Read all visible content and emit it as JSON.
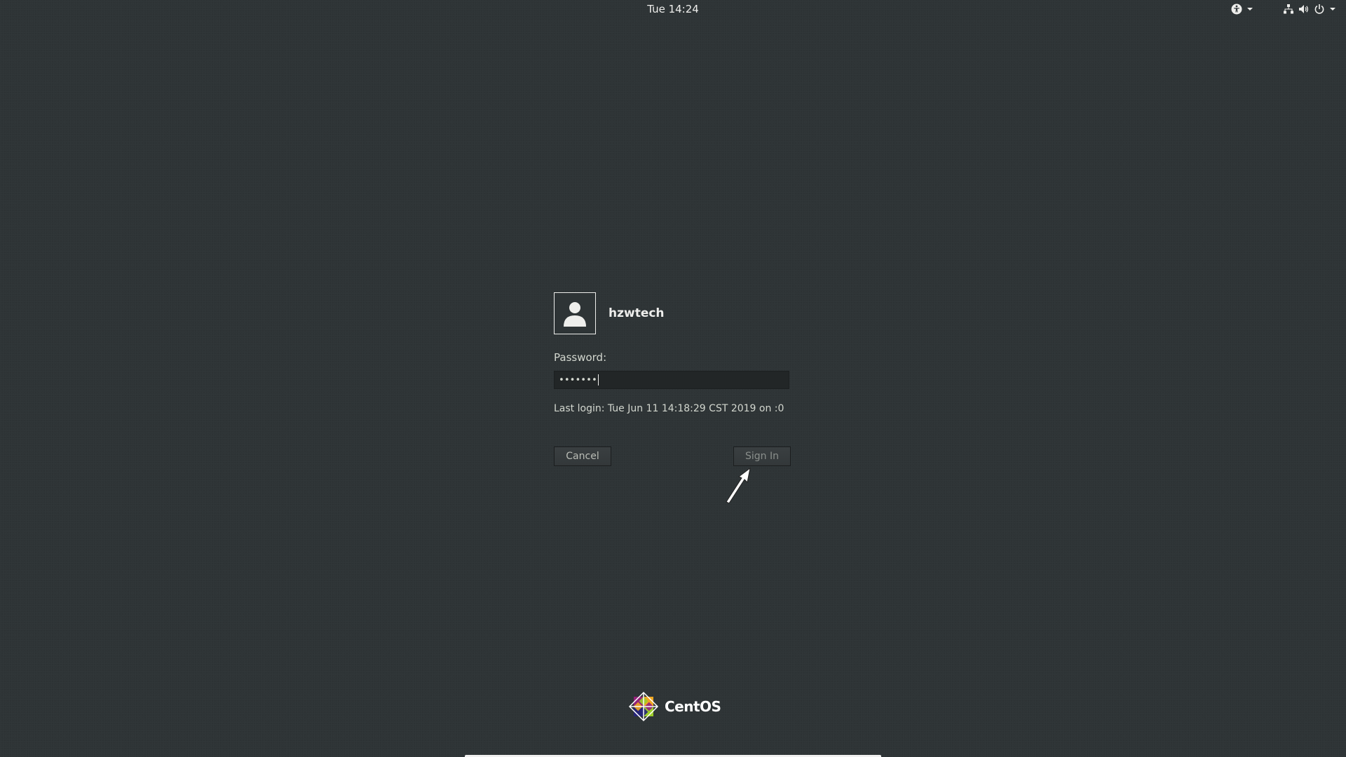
{
  "topbar": {
    "clock": "Tue 14:24",
    "icons": [
      "accessibility-icon",
      "network-icon",
      "volume-icon",
      "power-icon"
    ]
  },
  "login": {
    "username": "hzwtech",
    "password_label": "Password:",
    "password_value": "•••••••",
    "last_login": "Last login: Tue Jun 11 14:18:29 CST 2019 on :0",
    "cancel_label": "Cancel",
    "signin_label": "Sign In"
  },
  "branding": {
    "logo_text": "CentOS"
  },
  "colors": {
    "background": "#2e3436",
    "text": "#eeeeec"
  }
}
